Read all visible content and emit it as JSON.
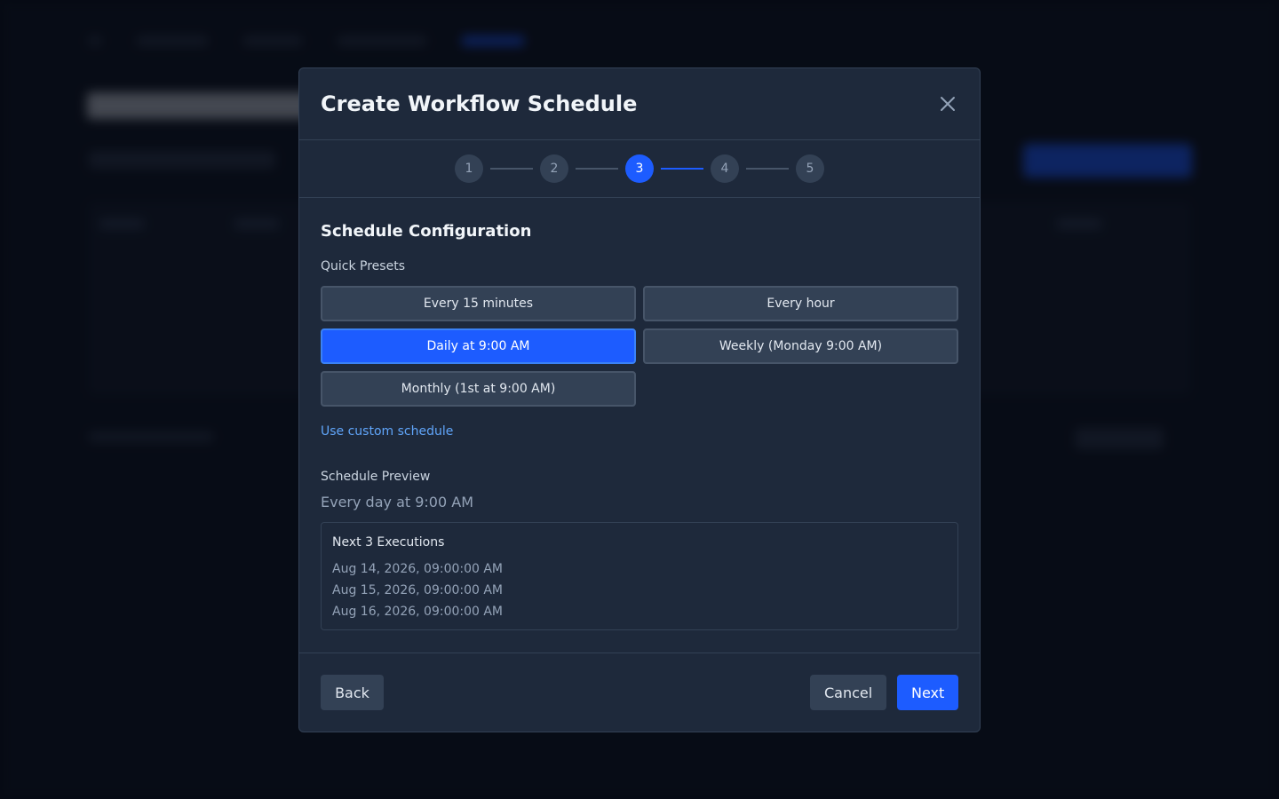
{
  "modal": {
    "title": "Create Workflow Schedule",
    "steps": [
      "1",
      "2",
      "3",
      "4",
      "5"
    ],
    "current_step": 3
  },
  "config": {
    "section_title": "Schedule Configuration",
    "presets_label": "Quick Presets",
    "presets": [
      {
        "label": "Every 15 minutes",
        "selected": false
      },
      {
        "label": "Every hour",
        "selected": false
      },
      {
        "label": "Daily at 9:00 AM",
        "selected": true
      },
      {
        "label": "Weekly (Monday 9:00 AM)",
        "selected": false
      },
      {
        "label": "Monthly (1st at 9:00 AM)",
        "selected": false
      }
    ],
    "custom_link": "Use custom schedule"
  },
  "preview": {
    "label": "Schedule Preview",
    "text": "Every day at 9:00 AM",
    "executions_title": "Next 3 Executions",
    "executions": [
      "Aug 14, 2026, 09:00:00 AM",
      "Aug 15, 2026, 09:00:00 AM",
      "Aug 16, 2026, 09:00:00 AM"
    ]
  },
  "footer": {
    "back_label": "Back",
    "cancel_label": "Cancel",
    "next_label": "Next"
  },
  "colors": {
    "accent": "#1d5cff",
    "link": "#60a5fa",
    "modal_bg": "#1e293b"
  },
  "icons": {
    "close": "close-icon"
  }
}
